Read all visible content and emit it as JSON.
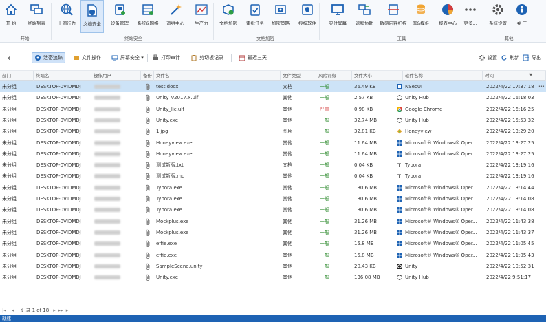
{
  "ribbon": {
    "items": [
      {
        "label": "开 始",
        "icon": "home-icon",
        "active": false
      },
      {
        "label": "终端列表",
        "icon": "monitors-icon",
        "active": false
      },
      {
        "label": "上网行为",
        "icon": "globe-search-icon",
        "active": false
      },
      {
        "label": "文档安全",
        "icon": "doc-shield-icon",
        "active": true
      },
      {
        "label": "设备管理",
        "icon": "device-icon",
        "active": false
      },
      {
        "label": "系统&网络",
        "icon": "network-icon",
        "active": false
      },
      {
        "label": "运维中心",
        "icon": "wand-icon",
        "active": false
      },
      {
        "label": "生产力",
        "icon": "chart-line-icon",
        "active": false
      },
      {
        "label": "文档加密",
        "icon": "encrypt-box-icon",
        "active": false
      },
      {
        "label": "审批任务",
        "icon": "approve-icon",
        "active": false
      },
      {
        "label": "加密策略",
        "icon": "policy-icon",
        "active": false
      },
      {
        "label": "授权软件",
        "icon": "auth-software-icon",
        "active": false
      },
      {
        "label": "实时屏幕",
        "icon": "screen-icon",
        "active": false
      },
      {
        "label": "远程协助",
        "icon": "remote-icon",
        "active": false
      },
      {
        "label": "敏感内容扫描",
        "icon": "scan-icon",
        "active": false
      },
      {
        "label": "库&模板",
        "icon": "database-icon",
        "active": false
      },
      {
        "label": "报表中心",
        "icon": "pie-icon",
        "active": false
      },
      {
        "label": "更多...",
        "icon": "more-icon",
        "active": false
      },
      {
        "label": "系统设置",
        "icon": "settings-icon",
        "active": false
      },
      {
        "label": "关 于",
        "icon": "info-icon",
        "active": false
      }
    ],
    "groups": [
      "开始",
      "终端安全",
      "文档加密",
      "工具",
      "其他"
    ]
  },
  "toolbar": {
    "back_label": "←",
    "buttons": [
      {
        "label": "泄密追踪",
        "icon": "trace-icon",
        "active": true
      },
      {
        "label": "文件操作",
        "icon": "folder-icon",
        "active": false
      },
      {
        "label": "屏幕安全 ▾",
        "icon": "screen-safe-icon",
        "active": false
      },
      {
        "label": "打印审计",
        "icon": "printer-icon",
        "active": false
      },
      {
        "label": "剪切板记录",
        "icon": "clipboard-icon",
        "active": false
      },
      {
        "label": "最近三天",
        "icon": "calendar-icon",
        "active": false
      }
    ],
    "right": [
      {
        "label": "设置",
        "icon": "gear-icon"
      },
      {
        "label": "刷新",
        "icon": "refresh-icon"
      },
      {
        "label": "导出",
        "icon": "export-icon"
      }
    ]
  },
  "table": {
    "headers": [
      "部门",
      "终端名",
      "操作用户",
      "备份",
      "文件名",
      "文件类型",
      "风险评级",
      "文件大小",
      "软件名称",
      "时间"
    ],
    "rows": [
      {
        "dept": "未分组",
        "terminal": "DESKTOP-0VIDMDJ",
        "file": "test.docx",
        "type": "文档",
        "risk": "一般",
        "size": "36.49 KB",
        "software": "NSecUI",
        "sw_icon": "nsec",
        "time": "2022/4/22 17:37:18",
        "selected": true
      },
      {
        "dept": "未分组",
        "terminal": "DESKTOP-0VIDMDJ",
        "file": "Unity_v2017.x.ulf",
        "type": "其他",
        "risk": "一般",
        "size": "2.57 KB",
        "software": "Unity Hub",
        "sw_icon": "unityhub",
        "time": "2022/4/22 16:18:03"
      },
      {
        "dept": "未分组",
        "terminal": "DESKTOP-0VIDMDJ",
        "file": "Unity_lic.ulf",
        "type": "其他",
        "risk": "严重",
        "size": "0.98 KB",
        "software": "Google Chrome",
        "sw_icon": "chrome",
        "time": "2022/4/22 16:16:25"
      },
      {
        "dept": "未分组",
        "terminal": "DESKTOP-0VIDMDJ",
        "file": "Unity.exe",
        "type": "其他",
        "risk": "一般",
        "size": "32.74 MB",
        "software": "Unity Hub",
        "sw_icon": "unityhub",
        "time": "2022/4/22 15:53:32"
      },
      {
        "dept": "未分组",
        "terminal": "DESKTOP-0VIDMDJ",
        "file": "1.jpg",
        "type": "图片",
        "risk": "一般",
        "size": "32.81 KB",
        "software": "Honeyview",
        "sw_icon": "honeyview",
        "time": "2022/4/22 13:29:20"
      },
      {
        "dept": "未分组",
        "terminal": "DESKTOP-0VIDMDJ",
        "file": "Honeyview.exe",
        "type": "其他",
        "risk": "一般",
        "size": "11.64 MB",
        "software": "Microsoft® Windows® Oper...",
        "sw_icon": "windows",
        "time": "2022/4/22 13:27:25"
      },
      {
        "dept": "未分组",
        "terminal": "DESKTOP-0VIDMDJ",
        "file": "Honeyview.exe",
        "type": "其他",
        "risk": "一般",
        "size": "11.64 MB",
        "software": "Microsoft® Windows® Oper...",
        "sw_icon": "windows",
        "time": "2022/4/22 13:27:25"
      },
      {
        "dept": "未分组",
        "terminal": "DESKTOP-0VIDMDJ",
        "file": "测试新版.txt",
        "type": "文档",
        "risk": "一般",
        "size": "0.04 KB",
        "software": "Typora",
        "sw_icon": "typora",
        "time": "2022/4/22 13:19:16"
      },
      {
        "dept": "未分组",
        "terminal": "DESKTOP-0VIDMDJ",
        "file": "测试新版.md",
        "type": "其他",
        "risk": "一般",
        "size": "0.04 KB",
        "software": "Typora",
        "sw_icon": "typora",
        "time": "2022/4/22 13:19:16"
      },
      {
        "dept": "未分组",
        "terminal": "DESKTOP-0VIDMDJ",
        "file": "Typora.exe",
        "type": "其他",
        "risk": "一般",
        "size": "130.6 MB",
        "software": "Microsoft® Windows® Oper...",
        "sw_icon": "windows",
        "time": "2022/4/22 13:14:44"
      },
      {
        "dept": "未分组",
        "terminal": "DESKTOP-0VIDMDJ",
        "file": "Typora.exe",
        "type": "其他",
        "risk": "一般",
        "size": "130.6 MB",
        "software": "Microsoft® Windows® Oper...",
        "sw_icon": "windows",
        "time": "2022/4/22 13:14:08"
      },
      {
        "dept": "未分组",
        "terminal": "DESKTOP-0VIDMDJ",
        "file": "Typora.exe",
        "type": "其他",
        "risk": "一般",
        "size": "130.6 MB",
        "software": "Microsoft® Windows® Oper...",
        "sw_icon": "windows",
        "time": "2022/4/22 13:14:08"
      },
      {
        "dept": "未分组",
        "terminal": "DESKTOP-0VIDMDJ",
        "file": "Mockplus.exe",
        "type": "其他",
        "risk": "一般",
        "size": "31.26 MB",
        "software": "Microsoft® Windows® Oper...",
        "sw_icon": "windows",
        "time": "2022/4/22 11:43:38"
      },
      {
        "dept": "未分组",
        "terminal": "DESKTOP-0VIDMDJ",
        "file": "Mockplus.exe",
        "type": "其他",
        "risk": "一般",
        "size": "31.26 MB",
        "software": "Microsoft® Windows® Oper...",
        "sw_icon": "windows",
        "time": "2022/4/22 11:43:37"
      },
      {
        "dept": "未分组",
        "terminal": "DESKTOP-0VIDMDJ",
        "file": "effie.exe",
        "type": "其他",
        "risk": "一般",
        "size": "15.8 MB",
        "software": "Microsoft® Windows® Oper...",
        "sw_icon": "windows",
        "time": "2022/4/22 11:05:45"
      },
      {
        "dept": "未分组",
        "terminal": "DESKTOP-0VIDMDJ",
        "file": "effie.exe",
        "type": "其他",
        "risk": "一般",
        "size": "15.8 MB",
        "software": "Microsoft® Windows® Oper...",
        "sw_icon": "windows",
        "time": "2022/4/22 11:05:43"
      },
      {
        "dept": "未分组",
        "terminal": "DESKTOP-0VIDMDJ",
        "file": "SampleScene.unity",
        "type": "其他",
        "risk": "一般",
        "size": "20.43 KB",
        "software": "Unity",
        "sw_icon": "unity",
        "time": "2022/4/22 10:52:31"
      },
      {
        "dept": "未分组",
        "terminal": "DESKTOP-0VIDMDJ",
        "file": "Unity.exe",
        "type": "其他",
        "risk": "一般",
        "size": "136.08 MB",
        "software": "Unity Hub",
        "sw_icon": "unityhub",
        "time": "2022/4/22 9:51:17"
      }
    ]
  },
  "pager": {
    "first": "|◂",
    "prev": "◂",
    "record_label": "记录 1 of 18",
    "next": "▸",
    "next_page": "▸▸",
    "last": "▸|"
  },
  "status": {
    "text": "就绪"
  },
  "colors": {
    "accent": "#1e63b4",
    "selected_row": "#cde3f7",
    "risk_low": "#2e8b2e",
    "risk_high": "#d43c3c"
  }
}
